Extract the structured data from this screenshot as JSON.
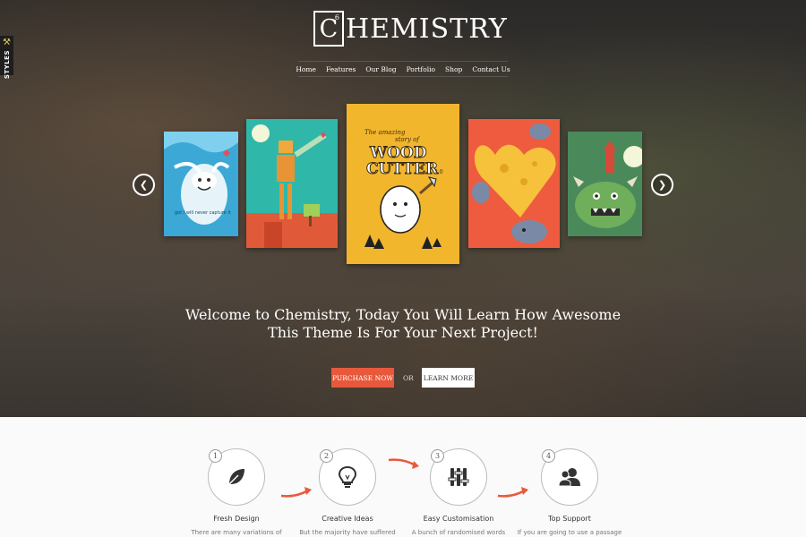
{
  "side_tab": {
    "label": "STYLES",
    "icon": "tools-icon"
  },
  "logo": {
    "boxed_letter": "C",
    "atomic_number": "6",
    "rest": "HEMISTRY"
  },
  "nav": [
    "Home",
    "Features",
    "Our Blog",
    "Portfolio",
    "Shop",
    "Contact Us"
  ],
  "carousel": {
    "prev_icon": "chevron-left-icon",
    "next_icon": "chevron-right-icon",
    "cards": [
      {
        "name": "yeti-poster",
        "text": "got I will never capture it"
      },
      {
        "name": "robot-poster",
        "text": ""
      },
      {
        "name": "woodcutter-poster",
        "line1": "The amazing",
        "line2": "story of",
        "line3": "WOOD",
        "line4": "CUTTER",
        "line5": "2.0"
      },
      {
        "name": "cheese-poster",
        "text": ""
      },
      {
        "name": "monster-poster",
        "text": ""
      }
    ]
  },
  "hero": {
    "headline_line1": "Welcome to Chemistry, Today You Will Learn How Awesome",
    "headline_line2": "This Theme Is For Your Next Project!",
    "primary_button": "PURCHASE NOW",
    "or_text": "OR",
    "secondary_button": "LEARN MORE",
    "accent_color": "#e8593c"
  },
  "features": [
    {
      "number": "1",
      "icon": "leaf-icon",
      "title": "Fresh Design",
      "desc": "There are many variations of"
    },
    {
      "number": "2",
      "icon": "lightbulb-icon",
      "title": "Creative Ideas",
      "desc": "But the majority have suffered"
    },
    {
      "number": "3",
      "icon": "sliders-icon",
      "title": "Easy Customisation",
      "desc": "A bunch of randomised words"
    },
    {
      "number": "4",
      "icon": "users-icon",
      "title": "Top Support",
      "desc": "If you are going to use a passage"
    }
  ]
}
